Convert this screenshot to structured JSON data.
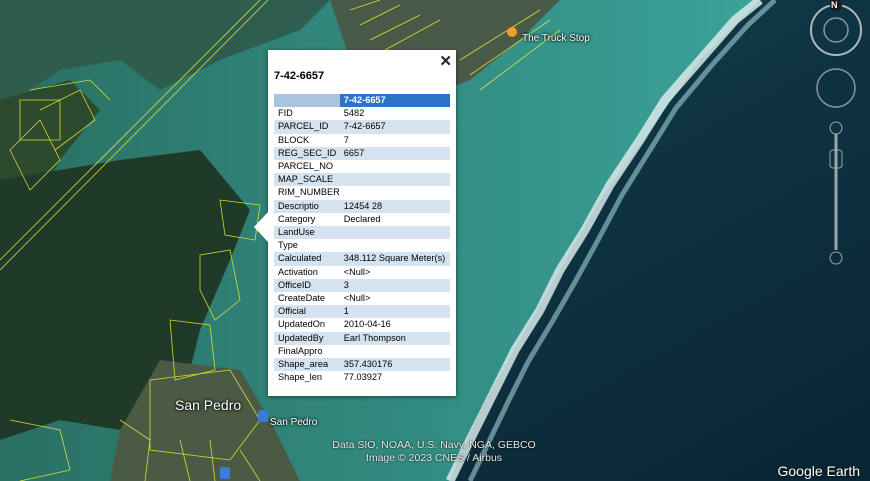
{
  "colors": {
    "land": "#24402c",
    "shallow_water": "#2f8d8a",
    "deep_water": "#0d2c3e",
    "reef": "#c7dede",
    "parcel_line": "#e7ea2e",
    "header_key": "#a9c3e0",
    "header_value": "#2b74c7",
    "row_alt": "#d5e3f1"
  },
  "map": {
    "labels": {
      "truck_stop": "The Truck Stop",
      "san_pedro_town": "San Pedro",
      "san_pedro_airport": "San Pedro"
    },
    "attribution_line1": "Data SIO, NOAA, U.S. Navy, NGA, GEBCO",
    "attribution_line2": "Image © 2023 CNES / Airbus",
    "logo": "Google Earth",
    "compass_north": "N"
  },
  "balloon": {
    "title": "7-42-6657",
    "close": "✕",
    "header_value": "7-42-6657",
    "rows": [
      {
        "key": "FID",
        "value": "5482"
      },
      {
        "key": "PARCEL_ID",
        "value": "7-42-6657"
      },
      {
        "key": "BLOCK",
        "value": "7"
      },
      {
        "key": "REG_SEC_ID",
        "value": "6657"
      },
      {
        "key": "PARCEL_NO",
        "value": ""
      },
      {
        "key": "MAP_SCALE",
        "value": ""
      },
      {
        "key": "RIM_NUMBER",
        "value": ""
      },
      {
        "key": "Descriptio",
        "value": "12454 28"
      },
      {
        "key": "Category",
        "value": "Declared"
      },
      {
        "key": "LandUse",
        "value": ""
      },
      {
        "key": "Type",
        "value": ""
      },
      {
        "key": "Calculated",
        "value": "348.112 Square Meter(s)"
      },
      {
        "key": "Activation",
        "value": "<Null>"
      },
      {
        "key": "OfficeID",
        "value": "3"
      },
      {
        "key": "CreateDate",
        "value": "<Null>"
      },
      {
        "key": "Official",
        "value": "1"
      },
      {
        "key": "UpdatedOn",
        "value": "2010-04-16"
      },
      {
        "key": "UpdatedBy",
        "value": "Earl Thompson"
      },
      {
        "key": "FinalAppro",
        "value": ""
      },
      {
        "key": "Shape_area",
        "value": "357.430176"
      },
      {
        "key": "Shape_len",
        "value": "77.03927"
      }
    ]
  },
  "icons": {
    "close": "close-icon",
    "poi_restaurant": "restaurant-pin-icon",
    "poi_airport": "airport-pin-icon",
    "compass": "compass-icon",
    "look": "look-joystick-icon",
    "move": "move-joystick-icon",
    "zoom": "zoom-slider-icon"
  }
}
